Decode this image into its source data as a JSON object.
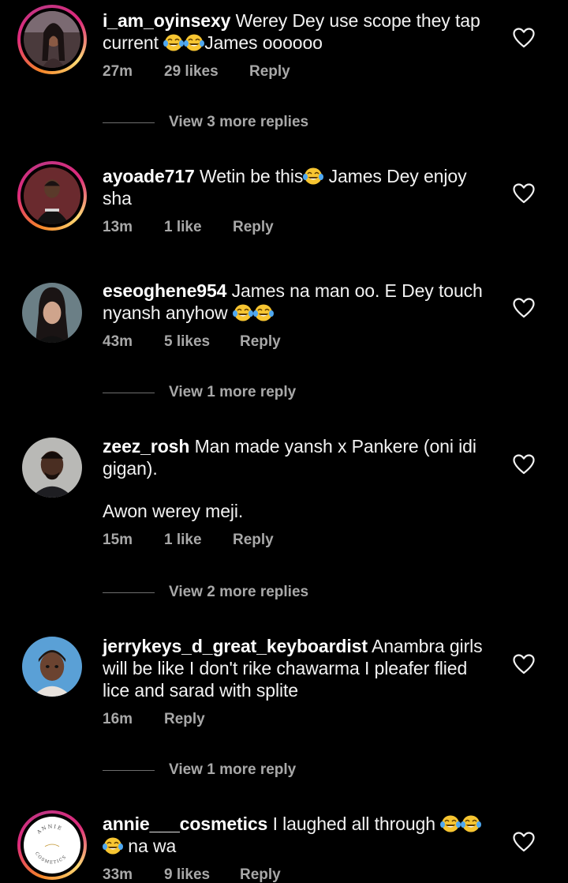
{
  "comments": [
    {
      "username": "i_am_oyinsexy",
      "text_before": "Werey Dey use scope they tap current ",
      "text_after": "James oooooo",
      "time": "27m",
      "likes": "29 likes",
      "reply": "Reply",
      "view_more": "View 3 more replies"
    },
    {
      "username": "ayoade717",
      "text_before": "Wetin be this",
      "text_after": " James Dey enjoy sha",
      "time": "13m",
      "likes": "1 like",
      "reply": "Reply"
    },
    {
      "username": "eseoghene954",
      "text_before": "James na man oo. E Dey touch nyansh anyhow ",
      "text_after": "",
      "time": "43m",
      "likes": "5 likes",
      "reply": "Reply",
      "view_more": "View 1 more reply"
    },
    {
      "username": "zeez_rosh",
      "text_before": "Man made yansh x Pankere (oni idi gigan).",
      "text_after": "Awon werey meji.",
      "time": "15m",
      "likes": "1 like",
      "reply": "Reply",
      "view_more": "View 2 more replies"
    },
    {
      "username": "jerrykeys_d_great_keyboardist",
      "text_before": "Anambra girls will be like I don't rike chawarma I pleafer flied lice and sarad with splite",
      "text_after": "",
      "time": "16m",
      "reply": "Reply",
      "view_more": "View 1 more reply"
    },
    {
      "username": "annie___cosmetics",
      "text_before": "I laughed all through ",
      "text_after": " na wa",
      "time": "33m",
      "likes": "9 likes",
      "reply": "Reply",
      "avatar_text_top": "ANNIE",
      "avatar_text_bottom": "COSMETICS"
    }
  ],
  "colors": {
    "background": "#000000",
    "text": "#f2f2f2",
    "meta": "#a8a8a8",
    "story_ring": [
      "#f58529",
      "#dd2a7b",
      "#feda75"
    ]
  },
  "icons": {
    "like": "heart-outline-icon",
    "emoji": "face-with-tears-of-joy-emoji"
  }
}
